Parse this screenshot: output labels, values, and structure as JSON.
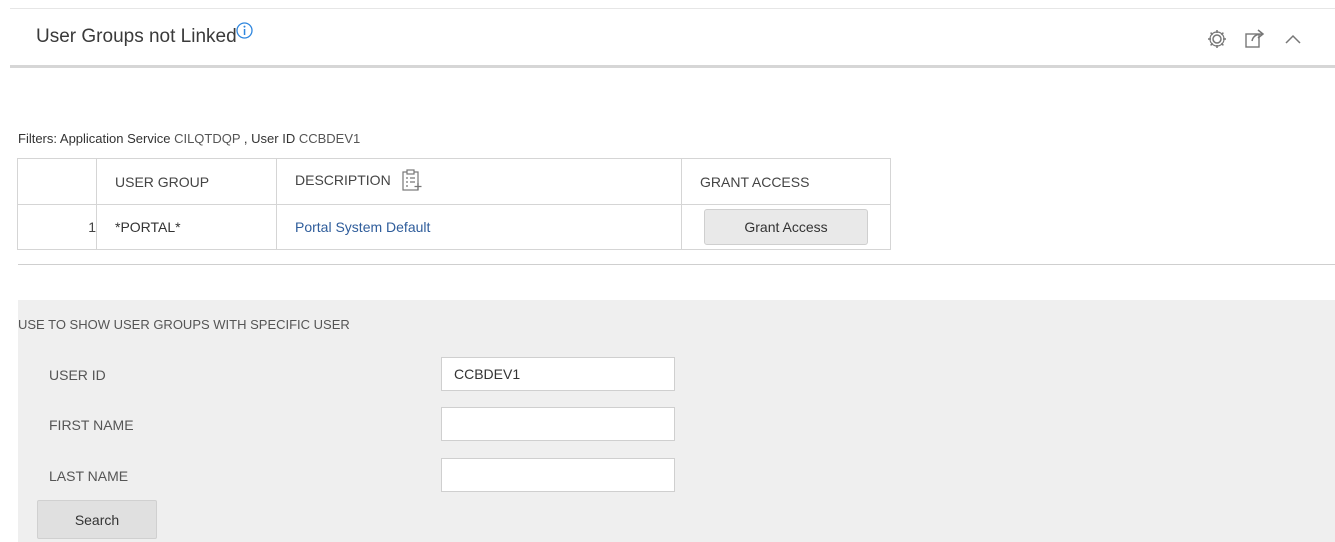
{
  "header": {
    "title": "User Groups not Linked",
    "info_icon": "info-icon",
    "tools": [
      "gear-icon",
      "share-icon",
      "chevron-up-icon"
    ]
  },
  "filters": {
    "prefix": "Filters: Application Service",
    "service_value": "CILQTDQP",
    "user_label": ", User ID",
    "user_value": "CCBDEV1"
  },
  "table": {
    "headers": [
      "",
      "USER GROUP",
      "DESCRIPTION",
      "GRANT ACCESS"
    ],
    "rows": [
      {
        "num": "1",
        "group": "*PORTAL*",
        "description": "Portal System Default",
        "action": "Grant Access"
      }
    ]
  },
  "search": {
    "title": "USE TO SHOW USER GROUPS WITH SPECIFIC USER",
    "fields": [
      {
        "label": "USER ID",
        "value": "CCBDEV1"
      },
      {
        "label": "FIRST NAME",
        "value": ""
      },
      {
        "label": "LAST NAME",
        "value": ""
      }
    ],
    "button": "Search"
  },
  "colors": {
    "link": "#2f5d9b",
    "info": "#2e86de",
    "panel": "#efefef"
  }
}
